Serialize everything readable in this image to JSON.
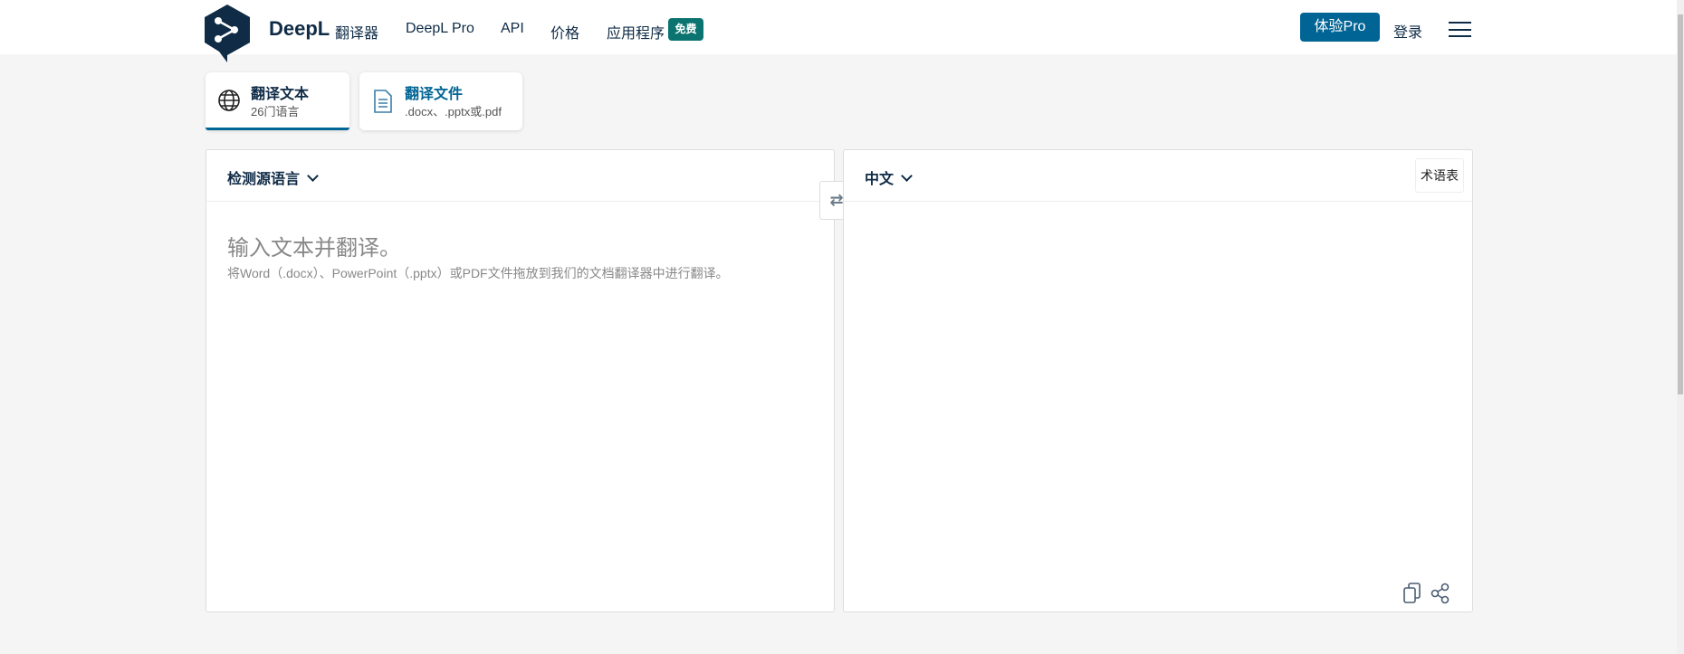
{
  "header": {
    "brand": "DeepL",
    "brand_sub": "翻译器",
    "nav": [
      "DeepL Pro",
      "API",
      "价格",
      "应用程序"
    ],
    "badge": "免费",
    "pro_button": "体验Pro",
    "login": "登录"
  },
  "tabs": [
    {
      "title": "翻译文本",
      "subtitle": "26门语言",
      "active": true
    },
    {
      "title": "翻译文件",
      "subtitle": ".docx、.pptx或.pdf",
      "active": false
    }
  ],
  "source": {
    "language": "检测源语言",
    "placeholder": "输入文本并翻译。",
    "hint": "将Word（.docx）、PowerPoint（.pptx）或PDF文件拖放到我们的文档翻译器中进行翻译。"
  },
  "target": {
    "language": "中文",
    "glossary": "术语表"
  },
  "colors": {
    "accent": "#006494",
    "badge": "#0c7470",
    "navy": "#0f2b46"
  }
}
